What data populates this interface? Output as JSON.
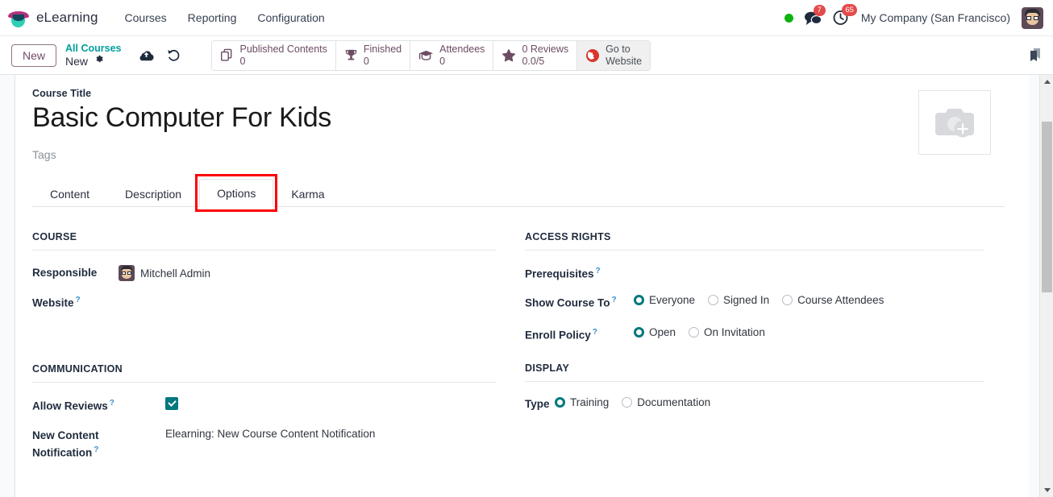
{
  "navbar": {
    "brand": "eLearning",
    "brand_logo_icon": "graduation-cap-icon",
    "menu": [
      {
        "label": "Courses"
      },
      {
        "label": "Reporting"
      },
      {
        "label": "Configuration"
      }
    ],
    "status_dot_color": "#0db30d",
    "messages_icon": "chat-bubble-icon",
    "messages_count": "7",
    "activities_icon": "clock-icon",
    "activities_count": "65",
    "company": "My Company (San Francisco)",
    "avatar_icon": "user-avatar-icon"
  },
  "control_panel": {
    "new_button": "New",
    "breadcrumb_parent": "All Courses",
    "breadcrumb_current": "New",
    "gear_icon": "gear-icon",
    "save_icon": "cloud-upload-icon",
    "discard_icon": "undo-icon",
    "bookmark_icon": "bookmark-icon",
    "stat_buttons": [
      {
        "icon": "copy-pages-icon",
        "label": "Published Contents",
        "value": "0"
      },
      {
        "icon": "trophy-icon",
        "label": "Finished",
        "value": "0"
      },
      {
        "icon": "graduation-cap-icon",
        "label": "Attendees",
        "value": "0"
      },
      {
        "icon": "star-icon",
        "label": "0 Reviews",
        "value": "0.0/5"
      }
    ],
    "go_to_website": {
      "icon": "globe-icon",
      "line1": "Go to",
      "line2": "Website"
    }
  },
  "form": {
    "title_label": "Course Title",
    "title_value": "Basic Computer For Kids",
    "tags_placeholder": "Tags",
    "image_placeholder_icon": "camera-add-icon",
    "tabs": [
      {
        "label": "Content",
        "active": false
      },
      {
        "label": "Description",
        "active": false
      },
      {
        "label": "Options",
        "active": true
      },
      {
        "label": "Karma",
        "active": false
      }
    ],
    "groups": {
      "course": {
        "title": "COURSE",
        "responsible_label": "Responsible",
        "responsible_value": "Mitchell Admin",
        "responsible_avatar_icon": "user-avatar-icon",
        "website_label": "Website",
        "website_value": ""
      },
      "access_rights": {
        "title": "ACCESS RIGHTS",
        "prerequisites_label": "Prerequisites",
        "prerequisites_value": "",
        "show_course_to_label": "Show Course To",
        "show_course_to_options": [
          {
            "label": "Everyone",
            "selected": true
          },
          {
            "label": "Signed In",
            "selected": false
          },
          {
            "label": "Course Attendees",
            "selected": false
          }
        ],
        "enroll_policy_label": "Enroll Policy",
        "enroll_policy_options": [
          {
            "label": "Open",
            "selected": true
          },
          {
            "label": "On Invitation",
            "selected": false
          }
        ]
      },
      "communication": {
        "title": "COMMUNICATION",
        "allow_reviews_label": "Allow Reviews",
        "allow_reviews_checked": true,
        "new_content_notification_label_line1": "New Content",
        "new_content_notification_label_line2": "Notification",
        "new_content_notification_value": "Elearning: New Course Content Notification"
      },
      "display": {
        "title": "DISPLAY",
        "type_label": "Type",
        "type_options": [
          {
            "label": "Training",
            "selected": true
          },
          {
            "label": "Documentation",
            "selected": false
          }
        ]
      }
    }
  },
  "annotation": {
    "highlight_color": "#ff0000",
    "target": "Options"
  },
  "colors": {
    "accent_teal": "#00787e",
    "brand_purple": "#714b67",
    "link_teal": "#00a09d",
    "badge_red": "#e34a4a"
  }
}
